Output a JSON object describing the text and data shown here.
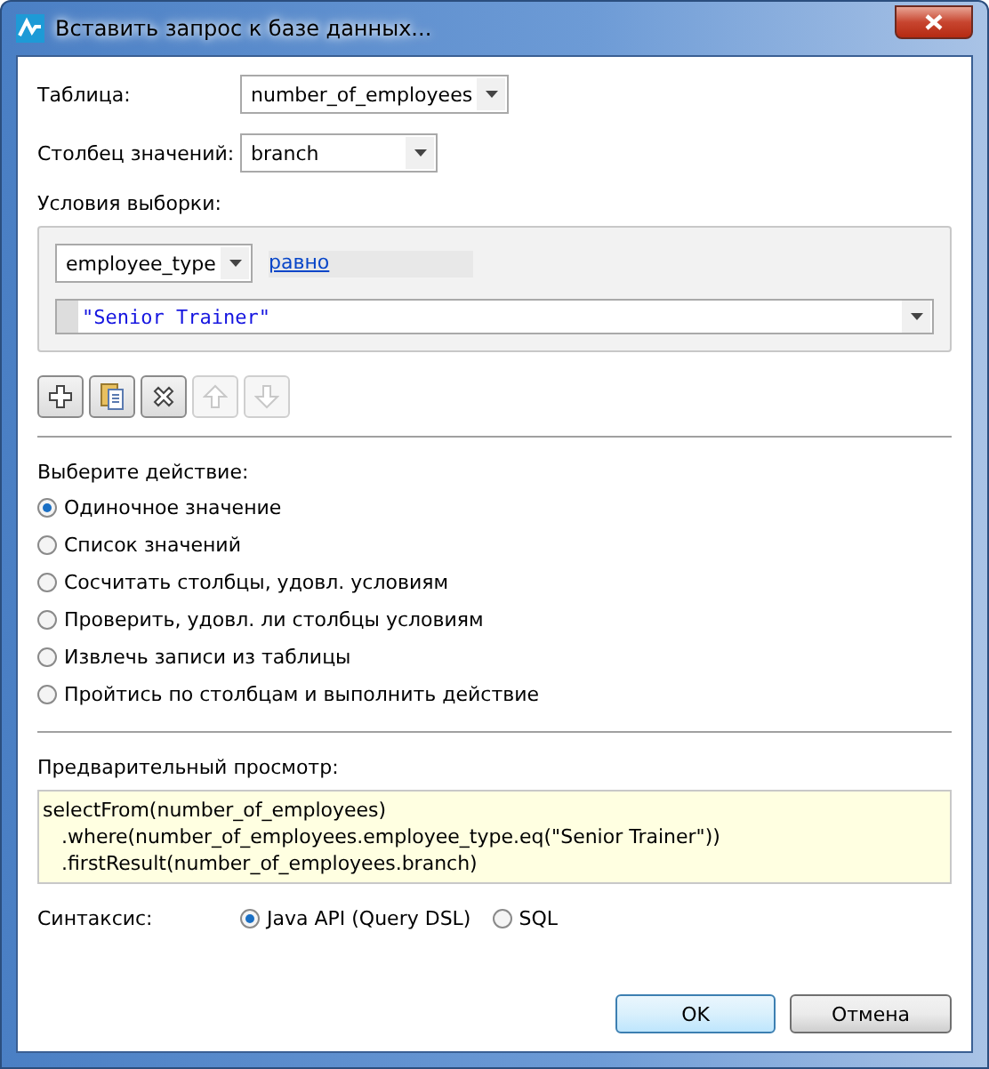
{
  "window": {
    "title": "Вставить запрос к базе данных..."
  },
  "table_field": {
    "label": "Таблица:",
    "value": "number_of_employees"
  },
  "column_field": {
    "label": "Столбец значений:",
    "value": "branch"
  },
  "conditions": {
    "label": "Условия выборки:",
    "column": "employee_type",
    "operator": "равно",
    "value": "\"Senior Trainer\""
  },
  "toolbar": [
    {
      "kind": "add",
      "disabled": false
    },
    {
      "kind": "paste",
      "disabled": false
    },
    {
      "kind": "delete",
      "disabled": false
    },
    {
      "kind": "up",
      "disabled": true
    },
    {
      "kind": "down",
      "disabled": true
    }
  ],
  "action": {
    "label": "Выберите действие:",
    "options": [
      {
        "label": "Одиночное значение",
        "selected": true
      },
      {
        "label": "Список значений",
        "selected": false
      },
      {
        "label": "Сосчитать столбцы, удовл. условиям",
        "selected": false
      },
      {
        "label": "Проверить, удовл. ли столбцы условиям",
        "selected": false
      },
      {
        "label": "Извлечь записи из таблицы",
        "selected": false
      },
      {
        "label": "Пройтись по столбцам и выполнить действие",
        "selected": false
      }
    ]
  },
  "preview": {
    "label": "Предварительный просмотр:",
    "lines": [
      "selectFrom(number_of_employees)",
      "   .where(number_of_employees.employee_type.eq(\"Senior Trainer\"))",
      "   .firstResult(number_of_employees.branch)"
    ]
  },
  "syntax": {
    "label": "Синтаксис:",
    "options": [
      {
        "label": "Java API (Query DSL)",
        "selected": true
      },
      {
        "label": "SQL",
        "selected": false
      }
    ]
  },
  "buttons": [
    {
      "label": "OK",
      "default": true
    },
    {
      "label": "Отмена",
      "default": false
    }
  ]
}
